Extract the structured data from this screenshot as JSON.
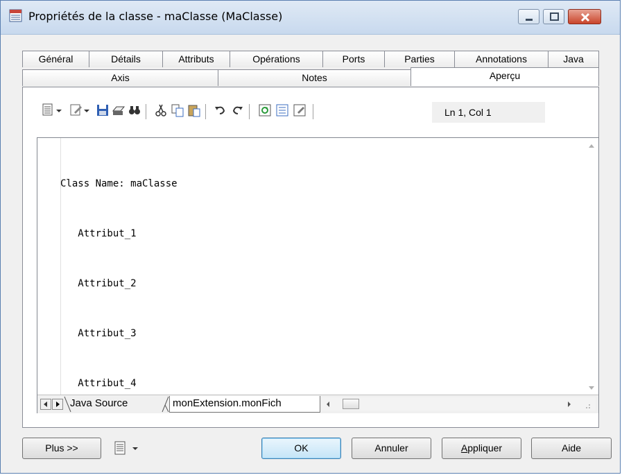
{
  "window": {
    "title": "Propriétés de la classe - maClasse (MaClasse)"
  },
  "tabs": {
    "row1": [
      "Général",
      "Détails",
      "Attributs",
      "Opérations",
      "Ports",
      "Parties",
      "Annotations",
      "Java"
    ],
    "row2": [
      "Axis",
      "Notes",
      "Aperçu"
    ],
    "active": "Aperçu"
  },
  "toolbar": {
    "icons": [
      "format-icon",
      "properties-icon",
      "save-icon",
      "print-icon",
      "find-icon",
      "cut-icon",
      "copy-icon",
      "paste-icon",
      "undo-icon",
      "redo-icon",
      "refresh-icon",
      "preview-options-icon",
      "edit-icon"
    ],
    "position": "Ln 1, Col 1"
  },
  "editor": {
    "lines": [
      "Class Name: maClasse",
      "   Attribut_1",
      "   Attribut_2",
      "   Attribut_3",
      "   Attribut_4"
    ],
    "sheet_tabs": [
      "Java Source",
      "monExtension.monFich"
    ]
  },
  "buttons": {
    "more": "Plus >>",
    "ok": "OK",
    "cancel": "Annuler",
    "apply_prefix": "",
    "apply_underlined": "A",
    "apply_rest": "ppliquer",
    "help": "Aide"
  },
  "colors": {
    "accent": "#3c7fb1",
    "close_button": "#c9452b",
    "window_border": "#5a7fb0"
  }
}
